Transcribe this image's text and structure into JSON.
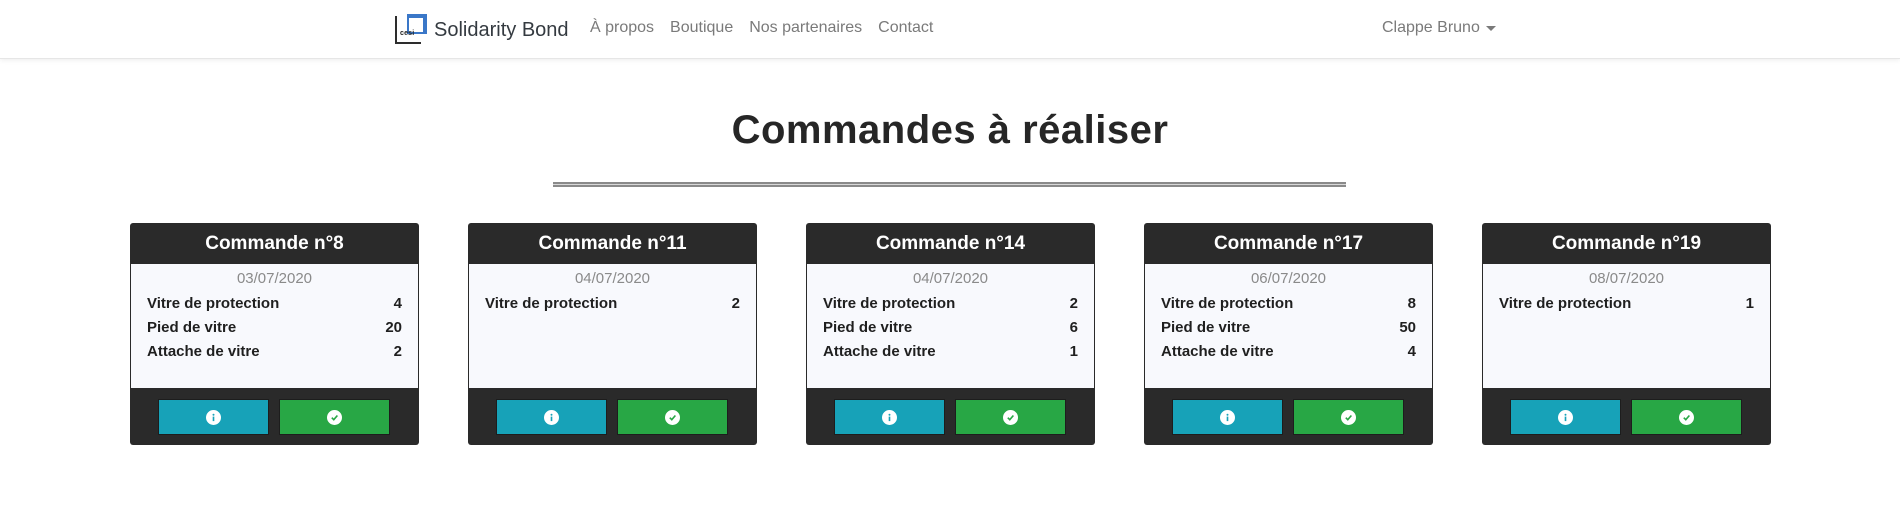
{
  "brand": {
    "logo_text": "cesi",
    "name": "Solidarity Bond"
  },
  "nav": {
    "links": [
      "À propos",
      "Boutique",
      "Nos partenaires",
      "Contact"
    ]
  },
  "user": {
    "name": "Clappe Bruno"
  },
  "page": {
    "title": "Commandes à réaliser"
  },
  "colors": {
    "info": "#17a2b8",
    "success": "#28a745",
    "card_dark": "#2a2a2a"
  },
  "orders": [
    {
      "title": "Commande n°8",
      "date": "03/07/2020",
      "items": [
        {
          "name": "Vitre de protection",
          "qty": "4"
        },
        {
          "name": "Pied de vitre",
          "qty": "20"
        },
        {
          "name": "Attache de vitre",
          "qty": "2"
        }
      ],
      "actions": {
        "info_icon": "info-icon",
        "validate_icon": "check-circle-icon"
      }
    },
    {
      "title": "Commande n°11",
      "date": "04/07/2020",
      "items": [
        {
          "name": "Vitre de protection",
          "qty": "2"
        }
      ],
      "actions": {
        "info_icon": "info-icon",
        "validate_icon": "check-circle-icon"
      }
    },
    {
      "title": "Commande n°14",
      "date": "04/07/2020",
      "items": [
        {
          "name": "Vitre de protection",
          "qty": "2"
        },
        {
          "name": "Pied de vitre",
          "qty": "6"
        },
        {
          "name": "Attache de vitre",
          "qty": "1"
        }
      ],
      "actions": {
        "info_icon": "info-icon",
        "validate_icon": "check-circle-icon"
      }
    },
    {
      "title": "Commande n°17",
      "date": "06/07/2020",
      "items": [
        {
          "name": "Vitre de protection",
          "qty": "8"
        },
        {
          "name": "Pied de vitre",
          "qty": "50"
        },
        {
          "name": "Attache de vitre",
          "qty": "4"
        }
      ],
      "actions": {
        "info_icon": "info-icon",
        "validate_icon": "check-circle-icon"
      }
    },
    {
      "title": "Commande n°19",
      "date": "08/07/2020",
      "items": [
        {
          "name": "Vitre de protection",
          "qty": "1"
        }
      ],
      "actions": {
        "info_icon": "info-icon",
        "validate_icon": "check-circle-icon"
      }
    }
  ]
}
